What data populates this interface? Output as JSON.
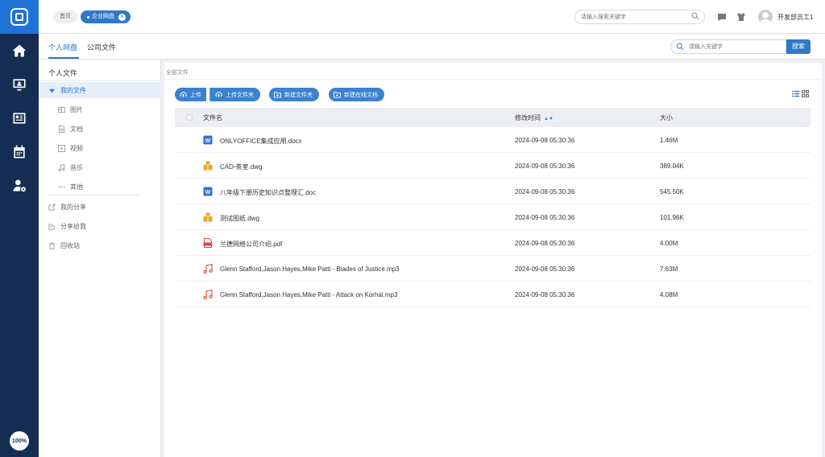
{
  "rail": {
    "zoom": "100%",
    "items": [
      {
        "icon": "home-icon"
      },
      {
        "icon": "monitor-user-icon"
      },
      {
        "icon": "news-icon"
      },
      {
        "icon": "calendar-icon"
      },
      {
        "icon": "user-settings-icon"
      }
    ]
  },
  "topbar": {
    "breadcrumb_home": "首页",
    "breadcrumb_tag": "企业网盘",
    "search_placeholder": "请输入搜索关键字",
    "username": "开发部员工1"
  },
  "subbar": {
    "tabs": [
      {
        "label": "个人网盘"
      },
      {
        "label": "公司文件"
      }
    ],
    "search_placeholder": "请输入关键字",
    "search_button": "搜索"
  },
  "tree": {
    "title": "个人文件",
    "my_files": "我的文件",
    "children": [
      {
        "label": "图片",
        "icon": "image-icon"
      },
      {
        "label": "文档",
        "icon": "document-icon"
      },
      {
        "label": "视频",
        "icon": "video-icon"
      },
      {
        "label": "音乐",
        "icon": "music-icon"
      },
      {
        "label": "其他",
        "icon": "more-icon"
      }
    ],
    "others": [
      {
        "label": "我的分享",
        "icon": "share-icon"
      },
      {
        "label": "分享给我",
        "icon": "shared-with-me-icon"
      },
      {
        "label": "回收站",
        "icon": "trash-icon"
      }
    ]
  },
  "main": {
    "breadcrumb": "全部文件",
    "buttons": {
      "upload": "上传",
      "upload_folder": "上传文件夹",
      "new_folder": "新建文件夹",
      "new_online_doc": "新建在线文档"
    },
    "columns": {
      "name": "文件名",
      "modified": "修改时间",
      "size": "大小"
    },
    "files": [
      {
        "name": "ONLYOFFICE集成应用.docx",
        "modified": "2024-09-08 05:30:36",
        "size": "1.46M",
        "type": "word"
      },
      {
        "name": "CAD-茶室.dwg",
        "modified": "2024-09-08 05:30:36",
        "size": "389.04K",
        "type": "cad"
      },
      {
        "name": "八年级下册历史知识点整理汇.doc",
        "modified": "2024-09-08 05:30:36",
        "size": "545.50K",
        "type": "word"
      },
      {
        "name": "测试图纸.dwg",
        "modified": "2024-09-08 05:30:36",
        "size": "101.96K",
        "type": "cad"
      },
      {
        "name": "兰德网络公司介绍.pdf",
        "modified": "2024-09-08 05:30:36",
        "size": "4.00M",
        "type": "pdf"
      },
      {
        "name": "Glenn Stafford,Jason Hayes,Mike Patti - Blades of Justice.mp3",
        "modified": "2024-09-08 05:30:36",
        "size": "7.63M",
        "type": "audio"
      },
      {
        "name": "Glenn Stafford,Jason Hayes,Mike Patti - Attack on Korhal.mp3",
        "modified": "2024-09-08 05:30:36",
        "size": "4.08M",
        "type": "audio"
      }
    ]
  },
  "colors": {
    "rail": "#152d52",
    "accent": "#2f78c9",
    "button": "#3b82d0",
    "word": "#2f6fd1",
    "cad": "#f0a623",
    "pdf": "#e0453a",
    "audio": "#e0453a"
  }
}
